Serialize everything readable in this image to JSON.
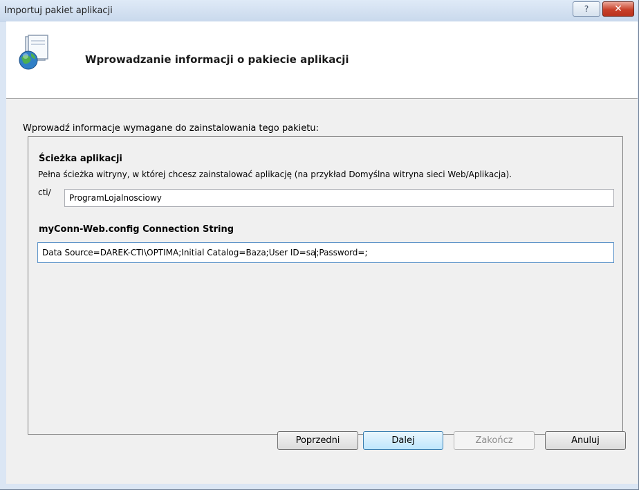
{
  "window": {
    "title": "Importuj pakiet aplikacji",
    "help_label": "?",
    "close_label": "✕"
  },
  "header": {
    "title": "Wprowadzanie informacji o pakiecie aplikacji",
    "icon": "package-globe-icon"
  },
  "instructions": "Wprowadź informacje wymagane do zainstalowania tego pakietu:",
  "app_path": {
    "label": "Ścieżka aplikacji",
    "description": "Pełna ścieżka witryny, w której chcesz zainstalować aplikację (na przykład Domyślna witryna sieci Web/Aplikacja).",
    "prefix": "cti/",
    "value": "ProgramLojalnosciowy"
  },
  "connection": {
    "label": "myConn-Web.config Connection String",
    "value_before_caret": "Data Source=DAREK-CTI\\OPTIMA;Initial Catalog=Baza;User ID=sa",
    "value_after_caret": ";Password=;"
  },
  "buttons": {
    "previous": "Poprzedni",
    "next": "Dalej",
    "finish": "Zakończ",
    "cancel": "Anuluj"
  }
}
